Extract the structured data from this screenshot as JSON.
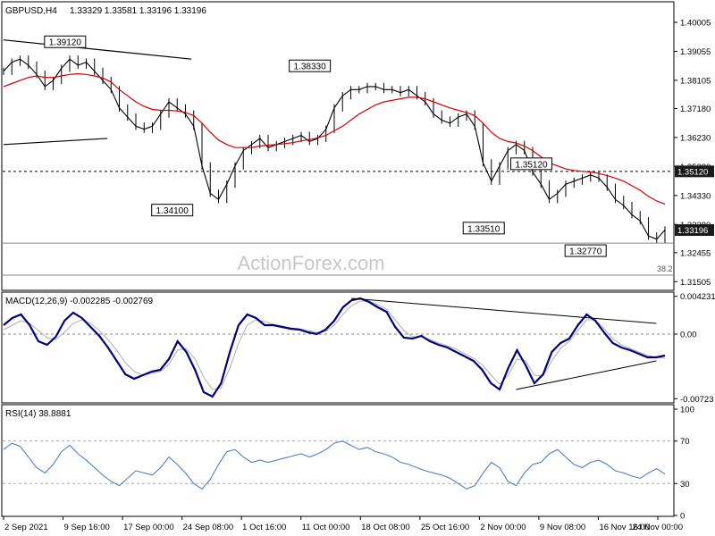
{
  "header": {
    "symbol": "GBPUSD,H4",
    "ohlc": "1.33329 1.33581 1.33196 1.33196"
  },
  "watermark": "ActionForex.com",
  "colors": {
    "price": "#000000",
    "ma": "#d40000",
    "macd": "#000080",
    "signal": "#b0b0b0",
    "rsi": "#4f80c8",
    "current_tag": "#1a1a1a"
  },
  "chart_data": [
    {
      "type": "line",
      "pane": "price",
      "ylim": [
        1.3125,
        1.4065
      ],
      "y_ticks": [
        1.40005,
        1.39055,
        1.38105,
        1.3718,
        1.3623,
        1.3528,
        1.3433,
        1.3338,
        1.32455,
        1.31505
      ],
      "y_tick_labels": [
        "1.40005",
        "1.39055",
        "1.38105",
        "1.37180",
        "1.36230",
        "1.35280",
        "1.34330",
        "1.33380",
        "1.32455",
        "1.31505"
      ],
      "x_labels": [
        "2 Sep 2021",
        "9 Sep 16:00",
        "17 Sep 00:00",
        "24 Sep 08:00",
        "1 Oct 16:00",
        "11 Oct 00:00",
        "18 Oct 08:00",
        "25 Oct 16:00",
        "2 Nov 00:00",
        "9 Nov 08:00",
        "16 Nov 16:00",
        "24 Nov 00:00"
      ],
      "series": [
        {
          "key": "close",
          "values": [
            1.384,
            1.387,
            1.388,
            1.386,
            1.383,
            1.379,
            1.381,
            1.385,
            1.388,
            1.386,
            1.387,
            1.384,
            1.381,
            1.378,
            1.372,
            1.369,
            1.366,
            1.365,
            1.366,
            1.37,
            1.374,
            1.372,
            1.37,
            1.366,
            1.353,
            1.344,
            1.342,
            1.347,
            1.353,
            1.358,
            1.36,
            1.362,
            1.359,
            1.36,
            1.361,
            1.362,
            1.363,
            1.361,
            1.362,
            1.365,
            1.372,
            1.376,
            1.378,
            1.378,
            1.379,
            1.379,
            1.378,
            1.378,
            1.377,
            1.378,
            1.376,
            1.374,
            1.37,
            1.368,
            1.367,
            1.369,
            1.37,
            1.366,
            1.354,
            1.348,
            1.353,
            1.358,
            1.36,
            1.358,
            1.351,
            1.347,
            1.342,
            1.344,
            1.347,
            1.348,
            1.349,
            1.35,
            1.349,
            1.346,
            1.342,
            1.34,
            1.337,
            1.335,
            1.33,
            1.329,
            1.332
          ]
        },
        {
          "key": "ma",
          "values": [
            1.379,
            1.38,
            1.381,
            1.382,
            1.3825,
            1.382,
            1.382,
            1.3825,
            1.383,
            1.3832,
            1.383,
            1.3825,
            1.3818,
            1.3805,
            1.378,
            1.376,
            1.374,
            1.3725,
            1.3715,
            1.3712,
            1.3712,
            1.371,
            1.3705,
            1.3695,
            1.367,
            1.364,
            1.3615,
            1.36,
            1.359,
            1.359,
            1.359,
            1.3595,
            1.3598,
            1.36,
            1.3603,
            1.3606,
            1.3612,
            1.3616,
            1.3622,
            1.363,
            1.3645,
            1.366,
            1.368,
            1.37,
            1.3715,
            1.373,
            1.374,
            1.3745,
            1.375,
            1.3755,
            1.3755,
            1.375,
            1.374,
            1.373,
            1.372,
            1.3712,
            1.3705,
            1.3695,
            1.367,
            1.364,
            1.362,
            1.361,
            1.3605,
            1.3595,
            1.358,
            1.356,
            1.354,
            1.353,
            1.352,
            1.3515,
            1.3512,
            1.351,
            1.3505,
            1.3498,
            1.349,
            1.348,
            1.3465,
            1.345,
            1.343,
            1.3415,
            1.3405
          ]
        }
      ],
      "levels": [
        {
          "value": 1.3512,
          "style": "dashed"
        },
        {
          "value": 1.3277,
          "style": "solid"
        },
        {
          "value": 1.3172,
          "style": "solid"
        }
      ],
      "trendlines": [
        {
          "p1": [
            0,
            1.3943
          ],
          "p2": [
            0.284,
            1.388
          ]
        },
        {
          "p1": [
            0,
            1.36
          ],
          "p2": [
            0.157,
            1.362
          ]
        }
      ],
      "annotations": [
        {
          "label": "1.39120",
          "x": 0.093,
          "value": 1.3912,
          "anchor": "top"
        },
        {
          "label": "1.38330",
          "x": 0.463,
          "value": 1.3833,
          "anchor": "top"
        },
        {
          "label": "1.34100",
          "x": 0.255,
          "value": 1.341,
          "anchor": "bottom"
        },
        {
          "label": "1.35120",
          "x": 0.798,
          "value": 1.3512,
          "anchor": "top"
        },
        {
          "label": "1.33510",
          "x": 0.726,
          "value": 1.3351,
          "anchor": "bottom"
        },
        {
          "label": "1.32770",
          "x": 0.88,
          "value": 1.3277,
          "anchor": "bottom"
        }
      ],
      "fib_label": "38.2",
      "right_tags": [
        {
          "label": "1.35120",
          "value": 1.3512
        },
        {
          "label": "1.33196",
          "value": 1.33196,
          "current": true
        }
      ]
    },
    {
      "type": "line",
      "pane": "macd",
      "title": "MACD(12,26,9) -0.002285 -0.002769",
      "ylim": [
        -0.0076,
        0.0046
      ],
      "y_ticks": [
        0.004231,
        0.0,
        -0.00723
      ],
      "y_tick_labels": [
        "0.004231",
        "0.00",
        "-0.00723"
      ],
      "series": [
        {
          "key": "macd",
          "values": [
            0.001,
            0.0018,
            0.0022,
            0.001,
            -0.0008,
            -0.0012,
            -0.0003,
            0.0015,
            0.0024,
            0.0018,
            0.0008,
            -0.0002,
            -0.0015,
            -0.003,
            -0.0045,
            -0.005,
            -0.0046,
            -0.0042,
            -0.004,
            -0.0028,
            -0.0008,
            -0.002,
            -0.004,
            -0.0065,
            -0.007,
            -0.0055,
            -0.002,
            0.001,
            0.0022,
            0.0018,
            0.001,
            0.001,
            0.0008,
            0.0006,
            0.0005,
            0.0002,
            0.0,
            0.0005,
            0.0015,
            0.003,
            0.0038,
            0.004,
            0.0036,
            0.003,
            0.0025,
            0.0008,
            -0.0004,
            -0.0005,
            -0.0002,
            -0.0008,
            -0.0012,
            -0.0015,
            -0.002,
            -0.0025,
            -0.003,
            -0.004,
            -0.0055,
            -0.0062,
            -0.0038,
            -0.0018,
            -0.0035,
            -0.0055,
            -0.0045,
            -0.002,
            -0.001,
            -0.0005,
            0.001,
            0.0022,
            0.0015,
            0.0002,
            -0.001,
            -0.0015,
            -0.0018,
            -0.0022,
            -0.0026,
            -0.0026,
            -0.0024
          ]
        },
        {
          "key": "signal",
          "values": [
            0.0005,
            0.001,
            0.0015,
            0.0012,
            0.0004,
            -0.0004,
            -0.0006,
            0.0002,
            0.0012,
            0.0016,
            0.0012,
            0.0004,
            -0.0006,
            -0.0018,
            -0.0032,
            -0.0042,
            -0.0046,
            -0.0044,
            -0.0042,
            -0.0034,
            -0.0018,
            -0.0016,
            -0.0028,
            -0.0048,
            -0.0062,
            -0.006,
            -0.0038,
            -0.001,
            0.001,
            0.0016,
            0.0014,
            0.0011,
            0.0009,
            0.0007,
            0.0006,
            0.0004,
            0.0002,
            0.0003,
            0.001,
            0.0022,
            0.0032,
            0.0037,
            0.0037,
            0.0033,
            0.0028,
            0.0016,
            0.0004,
            -0.0003,
            -0.0003,
            -0.0006,
            -0.001,
            -0.0013,
            -0.0017,
            -0.0022,
            -0.0027,
            -0.0034,
            -0.0046,
            -0.0056,
            -0.0046,
            -0.0028,
            -0.003,
            -0.0046,
            -0.0047,
            -0.003,
            -0.0016,
            -0.0008,
            0.0004,
            0.0016,
            0.0016,
            0.0006,
            -0.0005,
            -0.0012,
            -0.0016,
            -0.002,
            -0.0024,
            -0.0026,
            -0.0027
          ]
        }
      ],
      "trendlines": [
        {
          "p1": [
            0.526,
            0.004
          ],
          "p2": [
            0.987,
            0.0012
          ]
        },
        {
          "p1": [
            0.775,
            -0.0062
          ],
          "p2": [
            0.987,
            -0.003
          ]
        }
      ]
    },
    {
      "type": "line",
      "pane": "rsi",
      "title": "RSI(14) 38.8881",
      "ylim": [
        0,
        100
      ],
      "y_ticks": [
        100,
        70,
        30,
        0
      ],
      "y_tick_labels": [
        "100",
        "70",
        "30",
        "0"
      ],
      "levels": [
        70,
        30
      ],
      "series": [
        {
          "key": "rsi",
          "values": [
            62,
            68,
            65,
            55,
            45,
            40,
            48,
            60,
            66,
            58,
            52,
            45,
            38,
            32,
            28,
            35,
            42,
            40,
            38,
            45,
            55,
            48,
            40,
            30,
            25,
            34,
            48,
            60,
            62,
            55,
            50,
            52,
            50,
            52,
            54,
            56,
            58,
            55,
            58,
            62,
            68,
            70,
            66,
            62,
            64,
            60,
            58,
            55,
            50,
            48,
            45,
            42,
            40,
            38,
            35,
            30,
            25,
            28,
            40,
            50,
            45,
            32,
            28,
            40,
            48,
            50,
            58,
            62,
            55,
            48,
            45,
            50,
            52,
            48,
            42,
            40,
            37,
            35,
            40,
            44,
            38.9
          ]
        }
      ]
    }
  ]
}
